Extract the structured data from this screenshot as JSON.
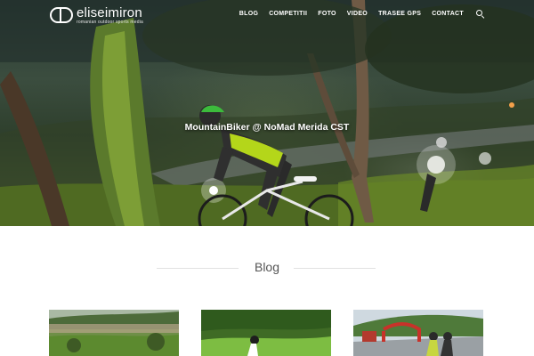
{
  "brand": {
    "name": "eliseimiron",
    "tagline": "romanian outdoor sports media"
  },
  "nav": {
    "items": [
      {
        "label": "BLOG"
      },
      {
        "label": "COMPETITII"
      },
      {
        "label": "FOTO"
      },
      {
        "label": "VIDEO"
      },
      {
        "label": "TRASEE GPS"
      },
      {
        "label": "CONTACT"
      }
    ],
    "search_icon": "search-icon"
  },
  "hero": {
    "caption": "MountainBiker @ NoMad Merida CST"
  },
  "blog": {
    "heading": "Blog"
  },
  "colors": {
    "nav_text": "#ffffff",
    "heading_text": "#555555",
    "divider": "#e2e2e2"
  }
}
